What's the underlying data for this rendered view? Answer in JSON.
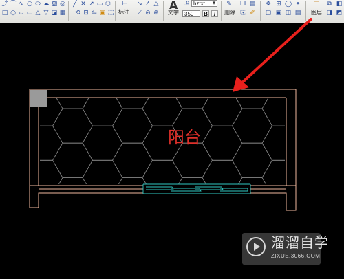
{
  "toolbar": {
    "annotate_label": "标注",
    "text_label": "文字",
    "delete_label": "删除",
    "layer_label": "图层",
    "font_name": "hztxt",
    "font_size": "350",
    "bold_label": "B",
    "italic_label": "I"
  },
  "drawing": {
    "room_label": "阳台"
  },
  "watermark": {
    "brand": "溜溜自学",
    "url": "ZIXUE.3066.COM"
  },
  "colors": {
    "arrow": "#e8201c",
    "wall": "#f0b89e",
    "hatch": "#888888",
    "window": "#2fc7c2",
    "label": "#e0302a"
  }
}
